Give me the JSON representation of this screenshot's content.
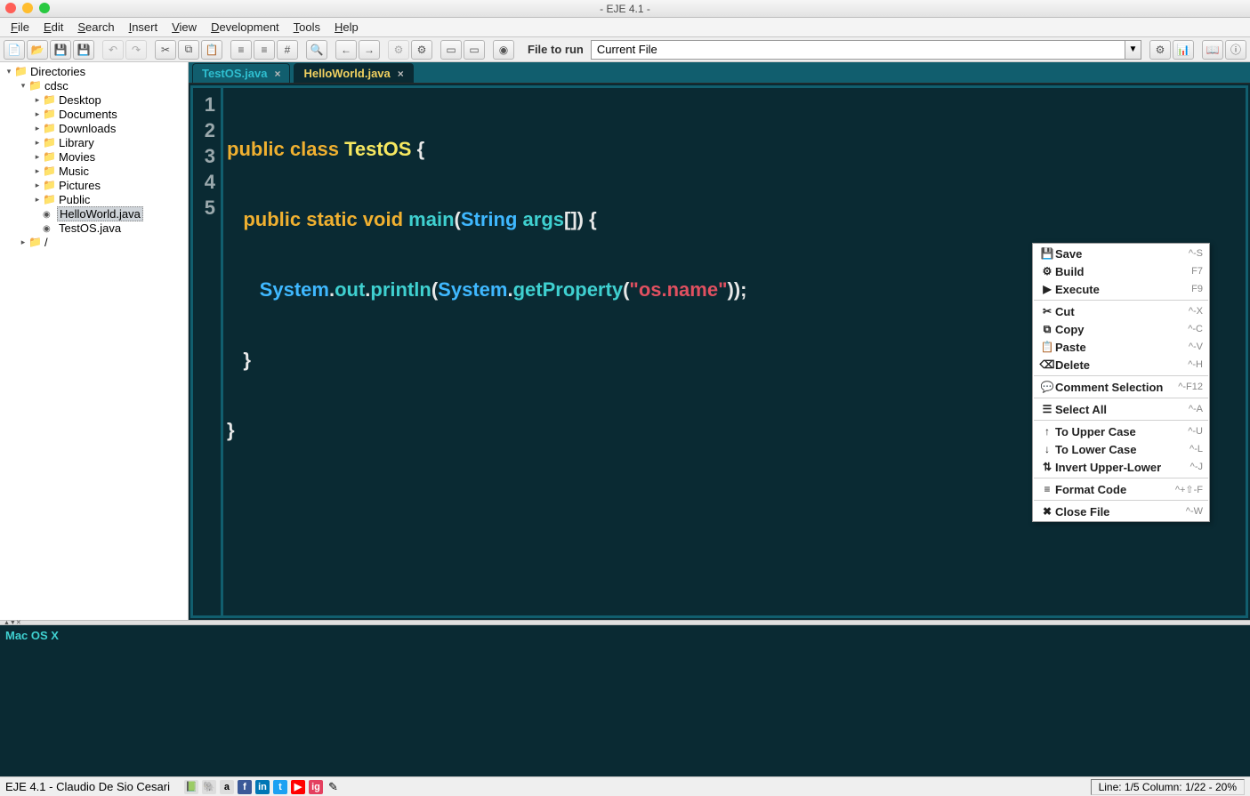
{
  "title": "- EJE 4.1 -",
  "menu": [
    "File",
    "Edit",
    "Search",
    "Insert",
    "View",
    "Development",
    "Tools",
    "Help"
  ],
  "toolbar": {
    "file_to_run_label": "File to run",
    "combo_value": "Current File"
  },
  "tree": {
    "root": "Directories",
    "cdsc": "cdsc",
    "items": [
      "Desktop",
      "Documents",
      "Downloads",
      "Library",
      "Movies",
      "Music",
      "Pictures",
      "Public"
    ],
    "files": [
      "HelloWorld.java",
      "TestOS.java"
    ],
    "slash": "/"
  },
  "tabs": [
    {
      "label": "TestOS.java",
      "active": false
    },
    {
      "label": "HelloWorld.java",
      "active": true
    }
  ],
  "code": {
    "line_numbers": [
      "1",
      "2",
      "3",
      "4",
      "5"
    ],
    "l1": {
      "a": "public class ",
      "b": "TestOS",
      "c": " {"
    },
    "l2": {
      "a": "   public static void ",
      "b": "main",
      "c": "(",
      "d": "String",
      "e": " args",
      "f": "[]) {"
    },
    "l3": {
      "a": "      System",
      "b": ".",
      "c": "out",
      "d": ".",
      "e": "println",
      "f": "(",
      "g": "System",
      "h": ".",
      "i": "getProperty",
      "j": "(",
      "k": "\"os.name\"",
      "l": "));"
    },
    "l4": "   }",
    "l5": "}"
  },
  "context_menu": {
    "groups": [
      [
        {
          "icon": "💾",
          "label": "Save",
          "shortcut": "^-S"
        },
        {
          "icon": "⚙",
          "label": "Build",
          "shortcut": "F7"
        },
        {
          "icon": "▶",
          "label": "Execute",
          "shortcut": "F9"
        }
      ],
      [
        {
          "icon": "✂",
          "label": "Cut",
          "shortcut": "^-X"
        },
        {
          "icon": "⧉",
          "label": "Copy",
          "shortcut": "^-C"
        },
        {
          "icon": "📋",
          "label": "Paste",
          "shortcut": "^-V"
        },
        {
          "icon": "⌫",
          "label": "Delete",
          "shortcut": "^-H"
        }
      ],
      [
        {
          "icon": "💬",
          "label": "Comment Selection",
          "shortcut": "^-F12"
        }
      ],
      [
        {
          "icon": "☰",
          "label": "Select All",
          "shortcut": "^-A"
        }
      ],
      [
        {
          "icon": "↑",
          "label": "To Upper Case",
          "shortcut": "^-U"
        },
        {
          "icon": "↓",
          "label": "To Lower Case",
          "shortcut": "^-L"
        },
        {
          "icon": "⇅",
          "label": "Invert Upper-Lower",
          "shortcut": "^-J"
        }
      ],
      [
        {
          "icon": "≡",
          "label": "Format Code",
          "shortcut": "^+⇧-F"
        }
      ],
      [
        {
          "icon": "✖",
          "label": "Close File",
          "shortcut": "^-W"
        }
      ]
    ]
  },
  "console_output": "Mac OS X",
  "status": {
    "left": "EJE 4.1 - Claudio De Sio Cesari",
    "right": "Line: 1/5 Column: 1/22 - 20%"
  },
  "social": [
    "f",
    "in",
    "t",
    "▶",
    "ig"
  ]
}
